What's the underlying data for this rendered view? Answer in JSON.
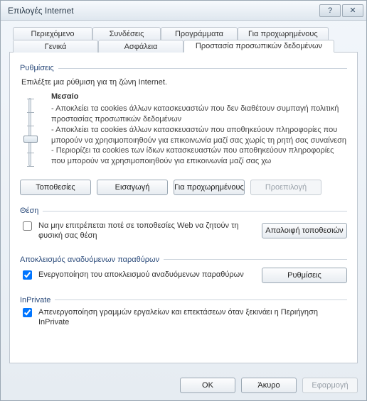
{
  "window": {
    "title": "Επιλογές Internet",
    "help_glyph": "?",
    "close_glyph": "✕"
  },
  "tabs": {
    "row1": [
      {
        "label": "Περιεχόμενο"
      },
      {
        "label": "Συνδέσεις"
      },
      {
        "label": "Προγράμματα"
      },
      {
        "label": "Για προχωρημένους"
      }
    ],
    "row2": [
      {
        "label": "Γενικά"
      },
      {
        "label": "Ασφάλεια"
      },
      {
        "label": "Προστασία προσωπικών δεδομένων",
        "active": true
      }
    ]
  },
  "settings": {
    "group_label": "Ρυθμίσεις",
    "instruction": "Επιλέξτε μια ρύθμιση για τη ζώνη Internet.",
    "level_title": "Μεσαίο",
    "level_lines": [
      "- Αποκλείει τα cookies άλλων κατασκευαστών που δεν διαθέτουν συμπαγή πολιτική προστασίας προσωπικών δεδομένων",
      "- Αποκλείει τα cookies άλλων κατασκευαστών που αποθηκεύουν πληροφορίες που μπορούν να χρησιμοποιηθούν για επικοινωνία μαζί σας χωρίς τη ρητή σας συναίνεση",
      "- Περιορίζει τα cookies των ίδιων κατασκευαστών που αποθηκεύουν πληροφορίες που μπορούν να χρησιμοποιηθούν για επικοινωνία μαζί σας χω"
    ],
    "buttons": {
      "sites": "Τοποθεσίες",
      "import": "Εισαγωγή",
      "advanced": "Για προχωρημένους",
      "default": "Προεπιλογή"
    }
  },
  "location": {
    "group_label": "Θέση",
    "checkbox_label": "Να μην επιτρέπεται ποτέ σε τοποθεσίες Web να ζητούν τη φυσική σας θέση",
    "clear_button": "Απαλοιφή τοποθεσιών"
  },
  "popup": {
    "group_label": "Αποκλεισμός αναδυόμενων παραθύρων",
    "checkbox_label": "Ενεργοποίηση του αποκλεισμού αναδυόμενων παραθύρων",
    "settings_button": "Ρυθμίσεις"
  },
  "inprivate": {
    "group_label": "InPrivate",
    "checkbox_label": "Απενεργοποίηση γραμμών εργαλείων και επεκτάσεων όταν ξεκινάει η Περιήγηση InPrivate"
  },
  "footer": {
    "ok": "OK",
    "cancel": "Άκυρο",
    "apply": "Εφαρμογή"
  }
}
